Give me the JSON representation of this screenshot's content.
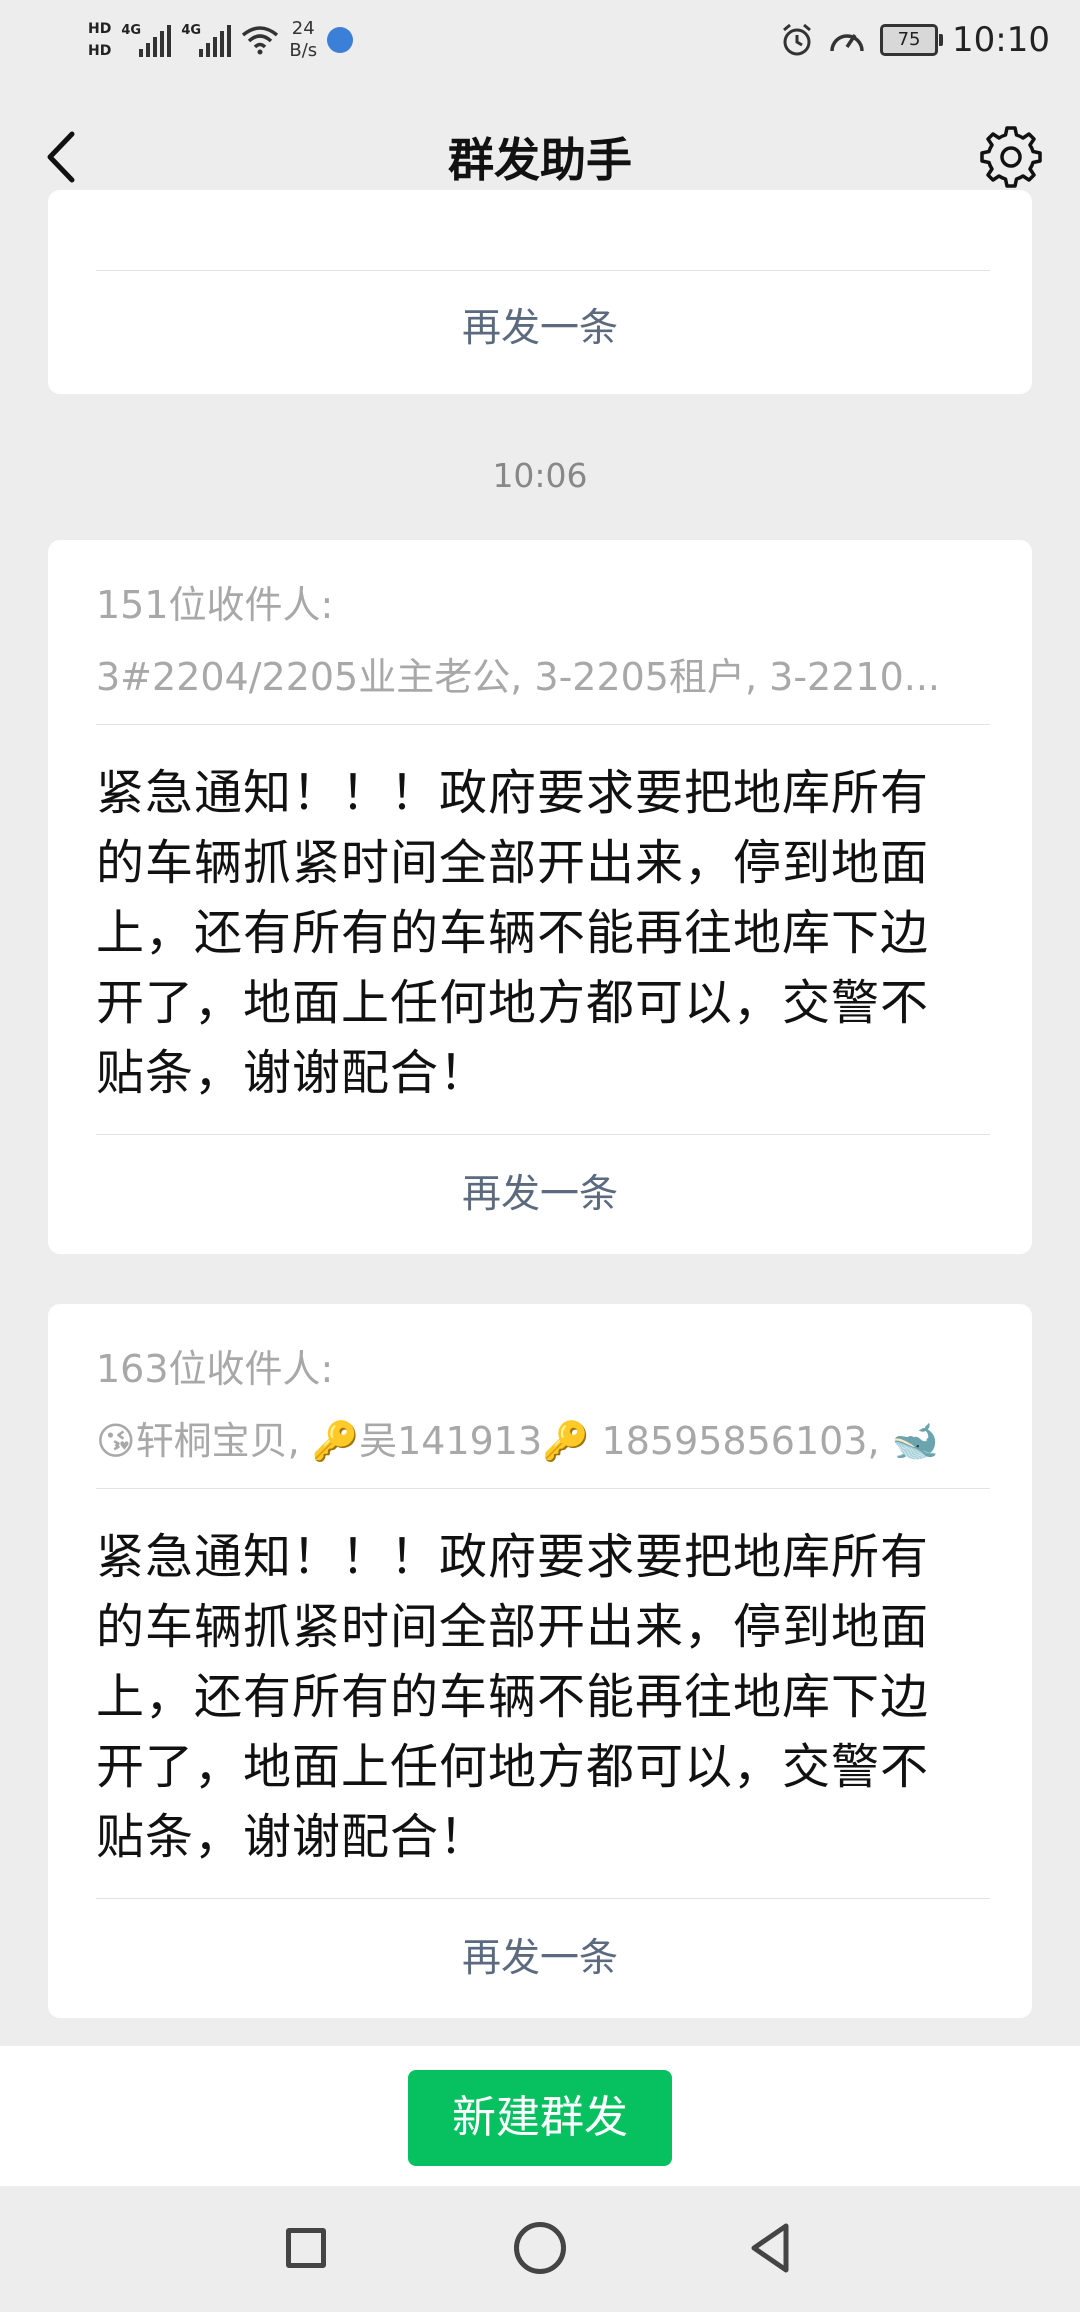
{
  "status_bar": {
    "hd1": "HD",
    "hd2": "HD",
    "sig1": "4G",
    "sig2": "4G",
    "speed_value": "24",
    "speed_unit": "B/s",
    "battery": "75",
    "time": "10:10"
  },
  "navbar": {
    "title": "群发助手"
  },
  "card1": {
    "resend_label": "再发一条"
  },
  "timestamp": "10:06",
  "card2": {
    "recipients_title": "151位收件人:",
    "recipients_list": "3#2204/2205业主老公, 3-2205租户, 3-2210...",
    "message": "紧急通知！！！政府要求要把地库所有的车辆抓紧时间全部开出来，停到地面上，还有所有的车辆不能再往地库下边开了，地面上任何地方都可以，交警不贴条，谢谢配合！",
    "resend_label": "再发一条"
  },
  "card3": {
    "recipients_title": "163位收件人:",
    "recipients_list": "😘轩桐宝贝, 🔑吴141913🔑 18595856103, 🐋",
    "message": "紧急通知！！！政府要求要把地库所有的车辆抓紧时间全部开出来，停到地面上，还有所有的车辆不能再往地库下边开了，地面上任何地方都可以，交警不贴条，谢谢配合！",
    "resend_label": "再发一条"
  },
  "bottom": {
    "new_broadcast_label": "新建群发"
  },
  "colors": {
    "accent_green": "#07c160",
    "background": "#ededed",
    "resend_text": "#5b6a7e"
  }
}
